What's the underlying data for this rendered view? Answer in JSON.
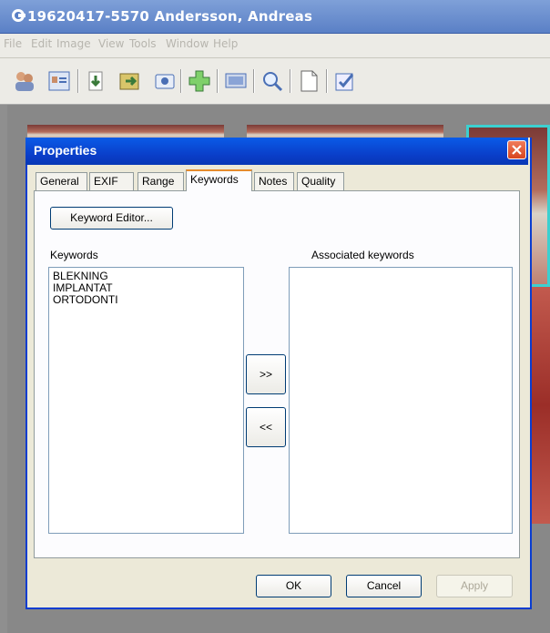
{
  "app": {
    "title": "19620417-5570 Andersson, Andreas",
    "menu": [
      "File",
      "Edit",
      "Image",
      "View",
      "Tools",
      "Window",
      "Help"
    ],
    "toolbar_icons": [
      "patients-icon",
      "patient-card-icon",
      "import-icon",
      "export-icon",
      "camera-icon",
      "add-icon",
      "monitor-icon",
      "search-icon",
      "document-icon",
      "checklist-icon"
    ]
  },
  "dialog": {
    "title": "Properties",
    "tabs": [
      "General",
      "EXIF",
      "Range",
      "Keywords",
      "Notes",
      "Quality"
    ],
    "active_tab": "Keywords",
    "keyword_editor_label": "Keyword Editor...",
    "keywords_label": "Keywords",
    "associated_label": "Associated keywords",
    "keywords": [
      "BLEKNING",
      "IMPLANTAT",
      "ORTODONTI"
    ],
    "associated_keywords": [],
    "add_label": ">>",
    "remove_label": "<<",
    "ok_label": "OK",
    "cancel_label": "Cancel",
    "apply_label": "Apply"
  }
}
